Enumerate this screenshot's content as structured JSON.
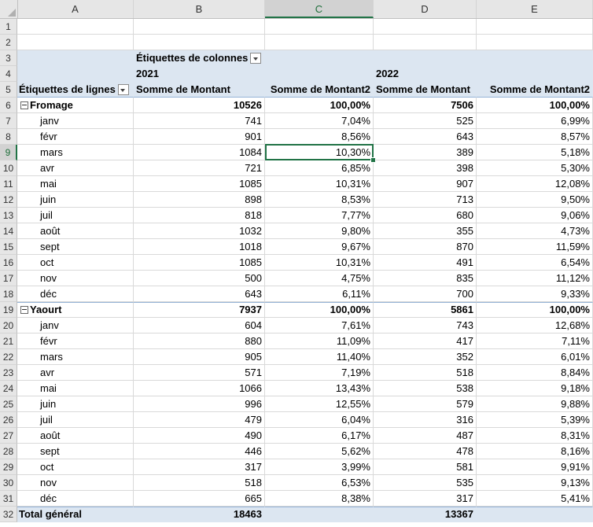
{
  "columns": [
    "A",
    "B",
    "C",
    "D",
    "E"
  ],
  "selected_column": "C",
  "selected_row": "9",
  "pivot": {
    "col_labels_header": "Étiquettes de colonnes",
    "row_labels_header": "Étiquettes de lignes",
    "year1": "2021",
    "year2": "2022",
    "measure1": "Somme de Montant",
    "measure2": "Somme de Montant2",
    "grand_total_label": "Total général",
    "grand_total_2021": "18463",
    "grand_total_2022": "13367"
  },
  "rows": [
    {
      "n": "1"
    },
    {
      "n": "2"
    },
    {
      "n": "3"
    },
    {
      "n": "4"
    },
    {
      "n": "5"
    },
    {
      "n": "6",
      "type": "group",
      "label": "Fromage",
      "b": "10526",
      "c": "100,00%",
      "d": "7506",
      "e": "100,00%"
    },
    {
      "n": "7",
      "type": "item",
      "label": "janv",
      "b": "741",
      "c": "7,04%",
      "d": "525",
      "e": "6,99%"
    },
    {
      "n": "8",
      "type": "item",
      "label": "févr",
      "b": "901",
      "c": "8,56%",
      "d": "643",
      "e": "8,57%"
    },
    {
      "n": "9",
      "type": "item",
      "label": "mars",
      "b": "1084",
      "c": "10,30%",
      "d": "389",
      "e": "5,18%"
    },
    {
      "n": "10",
      "type": "item",
      "label": "avr",
      "b": "721",
      "c": "6,85%",
      "d": "398",
      "e": "5,30%"
    },
    {
      "n": "11",
      "type": "item",
      "label": "mai",
      "b": "1085",
      "c": "10,31%",
      "d": "907",
      "e": "12,08%"
    },
    {
      "n": "12",
      "type": "item",
      "label": "juin",
      "b": "898",
      "c": "8,53%",
      "d": "713",
      "e": "9,50%"
    },
    {
      "n": "13",
      "type": "item",
      "label": "juil",
      "b": "818",
      "c": "7,77%",
      "d": "680",
      "e": "9,06%"
    },
    {
      "n": "14",
      "type": "item",
      "label": "août",
      "b": "1032",
      "c": "9,80%",
      "d": "355",
      "e": "4,73%"
    },
    {
      "n": "15",
      "type": "item",
      "label": "sept",
      "b": "1018",
      "c": "9,67%",
      "d": "870",
      "e": "11,59%"
    },
    {
      "n": "16",
      "type": "item",
      "label": "oct",
      "b": "1085",
      "c": "10,31%",
      "d": "491",
      "e": "6,54%"
    },
    {
      "n": "17",
      "type": "item",
      "label": "nov",
      "b": "500",
      "c": "4,75%",
      "d": "835",
      "e": "11,12%"
    },
    {
      "n": "18",
      "type": "item",
      "label": "déc",
      "b": "643",
      "c": "6,11%",
      "d": "700",
      "e": "9,33%"
    },
    {
      "n": "19",
      "type": "group",
      "label": "Yaourt",
      "b": "7937",
      "c": "100,00%",
      "d": "5861",
      "e": "100,00%"
    },
    {
      "n": "20",
      "type": "item",
      "label": "janv",
      "b": "604",
      "c": "7,61%",
      "d": "743",
      "e": "12,68%"
    },
    {
      "n": "21",
      "type": "item",
      "label": "févr",
      "b": "880",
      "c": "11,09%",
      "d": "417",
      "e": "7,11%"
    },
    {
      "n": "22",
      "type": "item",
      "label": "mars",
      "b": "905",
      "c": "11,40%",
      "d": "352",
      "e": "6,01%"
    },
    {
      "n": "23",
      "type": "item",
      "label": "avr",
      "b": "571",
      "c": "7,19%",
      "d": "518",
      "e": "8,84%"
    },
    {
      "n": "24",
      "type": "item",
      "label": "mai",
      "b": "1066",
      "c": "13,43%",
      "d": "538",
      "e": "9,18%"
    },
    {
      "n": "25",
      "type": "item",
      "label": "juin",
      "b": "996",
      "c": "12,55%",
      "d": "579",
      "e": "9,88%"
    },
    {
      "n": "26",
      "type": "item",
      "label": "juil",
      "b": "479",
      "c": "6,04%",
      "d": "316",
      "e": "5,39%"
    },
    {
      "n": "27",
      "type": "item",
      "label": "août",
      "b": "490",
      "c": "6,17%",
      "d": "487",
      "e": "8,31%"
    },
    {
      "n": "28",
      "type": "item",
      "label": "sept",
      "b": "446",
      "c": "5,62%",
      "d": "478",
      "e": "8,16%"
    },
    {
      "n": "29",
      "type": "item",
      "label": "oct",
      "b": "317",
      "c": "3,99%",
      "d": "581",
      "e": "9,91%"
    },
    {
      "n": "30",
      "type": "item",
      "label": "nov",
      "b": "518",
      "c": "6,53%",
      "d": "535",
      "e": "9,13%"
    },
    {
      "n": "31",
      "type": "item",
      "label": "déc",
      "b": "665",
      "c": "8,38%",
      "d": "317",
      "e": "5,41%"
    },
    {
      "n": "32",
      "type": "total"
    }
  ]
}
